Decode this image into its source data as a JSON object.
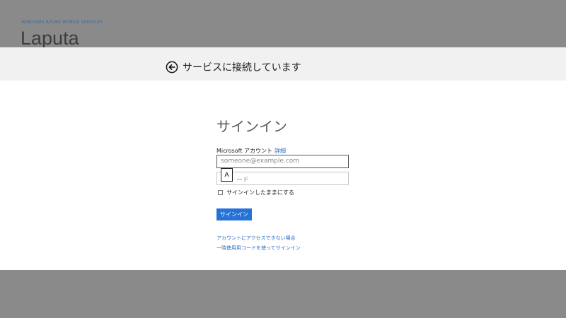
{
  "app": {
    "subtitle": "WINDOWS AZURE MOBILE SERVICES",
    "title": "Laputa"
  },
  "header": {
    "title": "サービスに接続しています",
    "back_icon": "back-arrow-circle-icon"
  },
  "signin": {
    "title": "サインイン",
    "account_label": "Microsoft アカウント",
    "details_link": "詳細",
    "email_placeholder": "someone@example.com",
    "password_placeholder": "ード",
    "ime_mode": "A",
    "keep_signed_in": "サインインしたままにする",
    "keep_signed_in_checked": false,
    "signin_button": "サインイン",
    "cant_access_link": "アカウントにアクセスできない場合",
    "one_time_code_link": "一時使用用コードを使ってサインイン"
  },
  "colors": {
    "overlay": "#8a8a8a",
    "header_band": "#f1f1f1",
    "accent": "#2672d6",
    "link": "#2b6cc4"
  }
}
